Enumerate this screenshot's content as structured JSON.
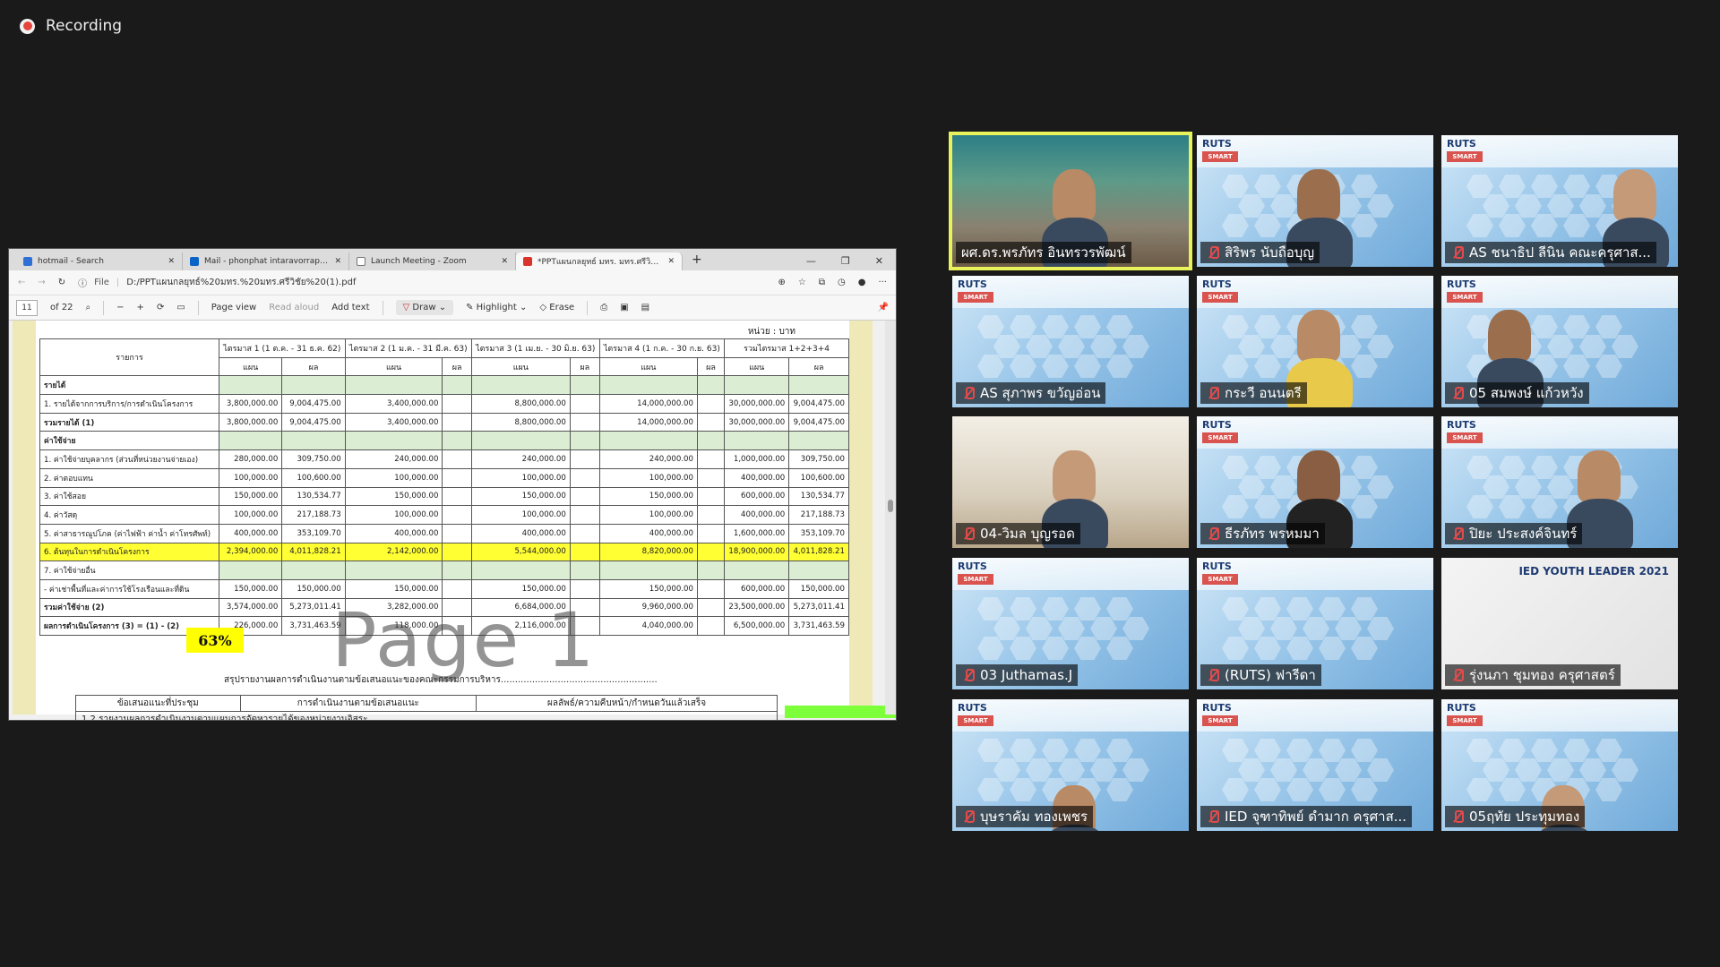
{
  "recording": {
    "label": "Recording"
  },
  "browser": {
    "tabs": [
      {
        "title": "hotmail - Search",
        "color": "#2f6fd6"
      },
      {
        "title": "Mail - phonphat intaravorraphat",
        "color": "#0a64c7"
      },
      {
        "title": "Launch Meeting - Zoom",
        "color": "#777777"
      },
      {
        "title": "*PPTแผนกลยุทธ์ มทร. มทร.ศรีวิชัย (1)",
        "color": "#d9342b"
      }
    ],
    "address": {
      "file_label": "File",
      "url": "D:/PPTแผนกลยุทธ์%20มทร.%20มทร.ศรีวิชัย%20(1).pdf"
    },
    "pdf_toolbar": {
      "page": "11",
      "of": "of 22",
      "page_view": "Page view",
      "read_aloud": "Read aloud",
      "add_text": "Add text",
      "draw": "Draw",
      "highlight": "Highlight",
      "erase": "Erase"
    }
  },
  "document": {
    "unit": "หน่วย : บาท",
    "headers": {
      "item": "รายการ",
      "quarters": [
        "ไตรมาส 1 (1 ต.ค. - 31 ธ.ค. 62)",
        "ไตรมาส 2 (1 ม.ค. - 31 มี.ค. 63)",
        "ไตรมาส 3 (1 เม.ย. - 30 มิ.ย. 63)",
        "ไตรมาส 4 (1 ก.ค. - 30 ก.ย. 63)",
        "รวมไตรมาส 1+2+3+4"
      ],
      "plan": "แผน",
      "result": "ผล"
    },
    "rows": [
      {
        "label": "รายได้",
        "cells": [
          "",
          "",
          "",
          "",
          "",
          "",
          "",
          "",
          "",
          ""
        ]
      },
      {
        "label": "1. รายได้จากการบริการ/การดำเนินโครงการ",
        "cells": [
          "3,800,000.00",
          "9,004,475.00",
          "3,400,000.00",
          "",
          "8,800,000.00",
          "",
          "14,000,000.00",
          "",
          "30,000,000.00",
          "9,004,475.00"
        ]
      },
      {
        "label": "รวมรายได้  (1)",
        "cells": [
          "3,800,000.00",
          "9,004,475.00",
          "3,400,000.00",
          "",
          "8,800,000.00",
          "",
          "14,000,000.00",
          "",
          "30,000,000.00",
          "9,004,475.00"
        ]
      },
      {
        "label": "ค่าใช้จ่าย",
        "cells": [
          "",
          "",
          "",
          "",
          "",
          "",
          "",
          "",
          "",
          ""
        ]
      },
      {
        "label": "1. ค่าใช้จ่ายบุคลากร (ส่วนที่หน่วยงานจ่ายเอง)",
        "cells": [
          "280,000.00",
          "309,750.00",
          "240,000.00",
          "",
          "240,000.00",
          "",
          "240,000.00",
          "",
          "1,000,000.00",
          "309,750.00"
        ]
      },
      {
        "label": "2. ค่าตอบแทน",
        "cells": [
          "100,000.00",
          "100,600.00",
          "100,000.00",
          "",
          "100,000.00",
          "",
          "100,000.00",
          "",
          "400,000.00",
          "100,600.00"
        ]
      },
      {
        "label": "3. ค่าใช้สอย",
        "cells": [
          "150,000.00",
          "130,534.77",
          "150,000.00",
          "",
          "150,000.00",
          "",
          "150,000.00",
          "",
          "600,000.00",
          "130,534.77"
        ]
      },
      {
        "label": "4. ค่าวัสดุ",
        "cells": [
          "100,000.00",
          "217,188.73",
          "100,000.00",
          "",
          "100,000.00",
          "",
          "100,000.00",
          "",
          "400,000.00",
          "217,188.73"
        ]
      },
      {
        "label": "5. ค่าสาธารณูปโภค (ค่าไฟฟ้า ค่าน้ำ ค่าโทรศัพท์)",
        "cells": [
          "400,000.00",
          "353,109.70",
          "400,000.00",
          "",
          "400,000.00",
          "",
          "400,000.00",
          "",
          "1,600,000.00",
          "353,109.70"
        ]
      },
      {
        "label": "6. ต้นทุนในการดำเนินโครงการ",
        "cells": [
          "2,394,000.00",
          "4,011,828.21",
          "2,142,000.00",
          "",
          "5,544,000.00",
          "",
          "8,820,000.00",
          "",
          "18,900,000.00",
          "4,011,828.21"
        ]
      },
      {
        "label": "7. ค่าใช้จ่ายอื่น",
        "cells": [
          "",
          "",
          "",
          "",
          "",
          "",
          "",
          "",
          "",
          ""
        ]
      },
      {
        "label": "- ค่าเช่าพื้นที่และค่าการใช้โรงเรือนและที่ดิน",
        "cells": [
          "150,000.00",
          "150,000.00",
          "150,000.00",
          "",
          "150,000.00",
          "",
          "150,000.00",
          "",
          "600,000.00",
          "150,000.00"
        ]
      },
      {
        "label": "รวมค่าใช้จ่าย  (2)",
        "cells": [
          "3,574,000.00",
          "5,273,011.41",
          "3,282,000.00",
          "",
          "6,684,000.00",
          "",
          "9,960,000.00",
          "",
          "23,500,000.00",
          "5,273,011.41"
        ]
      },
      {
        "label": "ผลการดำเนินโครงการ  (3) = (1) - (2)",
        "cells": [
          "226,000.00",
          "3,731,463.59",
          "118,000.00",
          "",
          "2,116,000.00",
          "",
          "4,040,000.00",
          "",
          "6,500,000.00",
          "3,731,463.59"
        ]
      }
    ],
    "percent_badge": "63%",
    "watermark": "Page 1",
    "summary_title": "สรุปรายงานผลการดำเนินงานตามข้อเสนอแนะของคณะกรรมการบริหาร.......................................................",
    "sub_headers": [
      "ข้อเสนอแนะที่ประชุม",
      "การดำเนินงานตามข้อเสนอแนะ",
      "ผลลัพธ์/ความคืบหน้า/กำหนดวันแล้วเสร็จ"
    ],
    "sub_row": "1.2 รายงานผลการดำเนินงานตามแผนการจัดหารายได้ของหน่วยงานอิสระ"
  },
  "participants": [
    {
      "name": "ผศ.ดร.พรภัทร อินทรวรพัฒน์",
      "muted": false,
      "bg": "room"
    },
    {
      "name": "สิริพร นับถือบุญ",
      "muted": true,
      "bg": "slide"
    },
    {
      "name": "AS ชนาธิป ลีนิน คณะครุศาส...",
      "muted": true,
      "bg": "slide"
    },
    {
      "name": "AS สุภาพร ขวัญอ่อน",
      "muted": true,
      "bg": "slide"
    },
    {
      "name": "กระวี อนนตรี",
      "muted": true,
      "bg": "slide"
    },
    {
      "name": "05 สมพงษ์ แก้วหวัง",
      "muted": true,
      "bg": "slide"
    },
    {
      "name": "04-วิมล บุญรอด",
      "muted": true,
      "bg": "wall"
    },
    {
      "name": "ธีรภัทร พรหมมา",
      "muted": true,
      "bg": "slide"
    },
    {
      "name": "ปิยะ ประสงค์จินทร์",
      "muted": true,
      "bg": "slide"
    },
    {
      "name": "03 Juthamas.J",
      "muted": true,
      "bg": "slide"
    },
    {
      "name": "(RUTS) ฟารีดา",
      "muted": true,
      "bg": "slide"
    },
    {
      "name": "รุ่งนภา ชุมทอง ครุศาสตร์",
      "muted": true,
      "bg": "white"
    },
    {
      "name": "บุษราคัม ทองเพชร",
      "muted": true,
      "bg": "slide"
    },
    {
      "name": "IED จุฑาทิพย์ ดำมาก ครุศาส...",
      "muted": true,
      "bg": "slide"
    },
    {
      "name": "05ฤทัย ประทุมทอง",
      "muted": true,
      "bg": "slide"
    }
  ],
  "slide_logo": {
    "ruts": "RUTS",
    "smart": "SMART"
  },
  "ied_text": "IED YOUTH LEADER 2021",
  "colors": {
    "speaker_outline": "#e8f25a",
    "highlight_row": "#ffff33",
    "mute_red": "#e34a4a"
  }
}
